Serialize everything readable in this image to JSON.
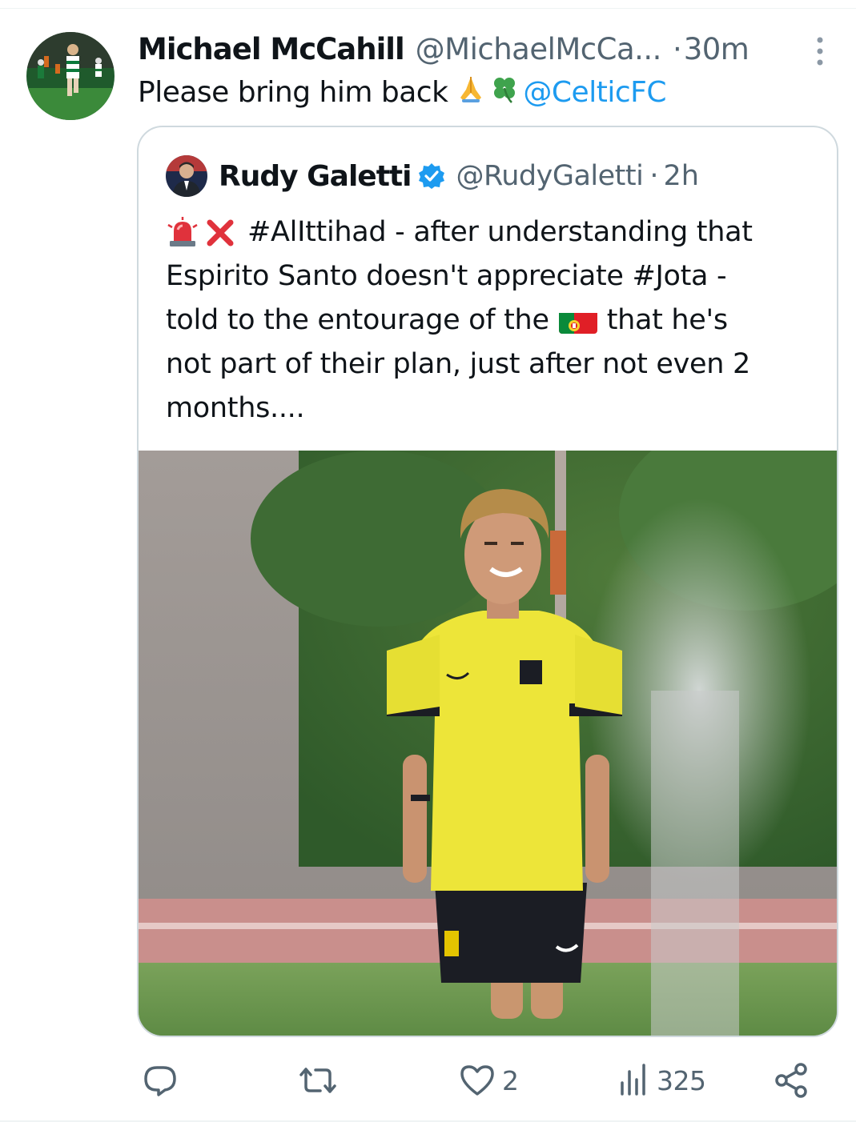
{
  "tweet": {
    "display_name": "Michael McCahill",
    "handle": "@MichaelMcCa...",
    "separator": "·",
    "time": "30m",
    "text": "Please bring him back",
    "emojis": [
      "folded-hands",
      "four-leaf-clover"
    ],
    "mention": "@CelticFC"
  },
  "quote": {
    "display_name": "Rudy Galetti",
    "verified": true,
    "handle": "@RudyGaletti",
    "separator": "·",
    "time": "2h",
    "lines": [
      "#AlIttihad - after understanding that",
      "Espirito Santo doesn't appreciate #Jota -",
      "told to the entourage of the",
      "that he's",
      "not part of their plan, just after not even 2",
      "months...."
    ],
    "emojis": [
      "rotating-light",
      "cross-mark",
      "portugal-flag"
    ]
  },
  "actions": {
    "reply_count": "",
    "retweet_count": "",
    "like_count": "2",
    "views_count": "325"
  },
  "colors": {
    "link": "#1d9bf0",
    "secondary_text": "#536471",
    "border": "#cfd9de",
    "verified": "#1d9bf0"
  }
}
